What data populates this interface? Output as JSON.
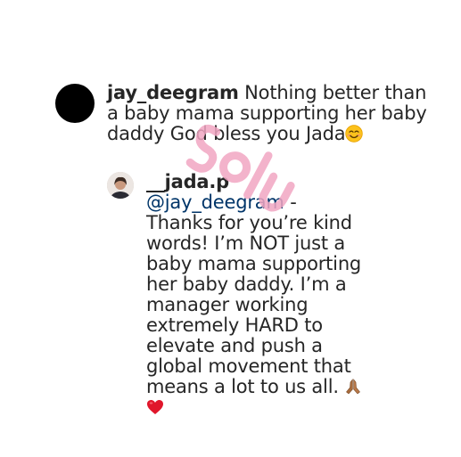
{
  "comment_1": {
    "username": "jay_deegram",
    "text": "Nothing better than a baby mama supporting her baby daddy God bless you Jada",
    "emoji_icon": "smiling-face-icon"
  },
  "reply_1": {
    "username": "__jada.p",
    "mention": "@jay_deegram",
    "text": "- Thanks for you’re kind words! I’m NOT just a baby mama supporting her baby daddy. I’m a manager working extremely HARD to elevate and push a global movement that means a lot to us all.",
    "emoji_icons": [
      "folded-hands-icon",
      "red-heart-icon"
    ]
  },
  "watermark": {
    "text": "5olu",
    "color": "#f2a6c3"
  },
  "colors": {
    "text": "#262626",
    "mention": "#003569",
    "avatar_1": "#000000"
  }
}
